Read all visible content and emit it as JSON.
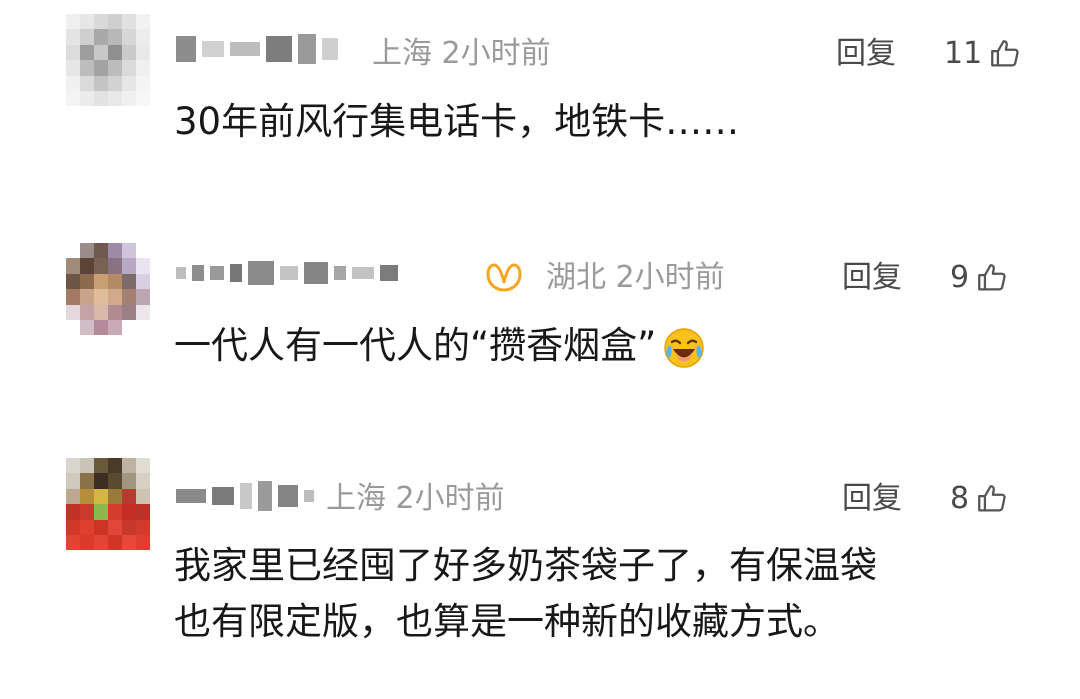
{
  "comments": [
    {
      "location": "上海",
      "time": "2小时前",
      "reply_label": "回复",
      "likes": "11",
      "text_lines": [
        "30年前风行集电话卡，地铁卡……"
      ],
      "avatar_icon": "pixelated-avatar",
      "has_badge": false
    },
    {
      "location": "湖北",
      "time": "2小时前",
      "reply_label": "回复",
      "likes": "9",
      "text_lines": [
        "一代人有一代人的“攒香烟盒”"
      ],
      "avatar_icon": "pixelated-avatar",
      "has_badge": true,
      "badge_icon": "butterfly-badge-icon",
      "trailing_emoji": "laughing-crying-emoji"
    },
    {
      "location": "上海",
      "time": "2小时前",
      "reply_label": "回复",
      "likes": "8",
      "text_lines": [
        "我家里已经囤了好多奶茶袋子了，有保温袋",
        "也有限定版，也算是一种新的收藏方式。"
      ],
      "avatar_icon": "pixelated-avatar",
      "has_badge": false
    }
  ],
  "colors": {
    "meta_text": "#9a9a9a",
    "badge_orange": "#f5a623"
  }
}
